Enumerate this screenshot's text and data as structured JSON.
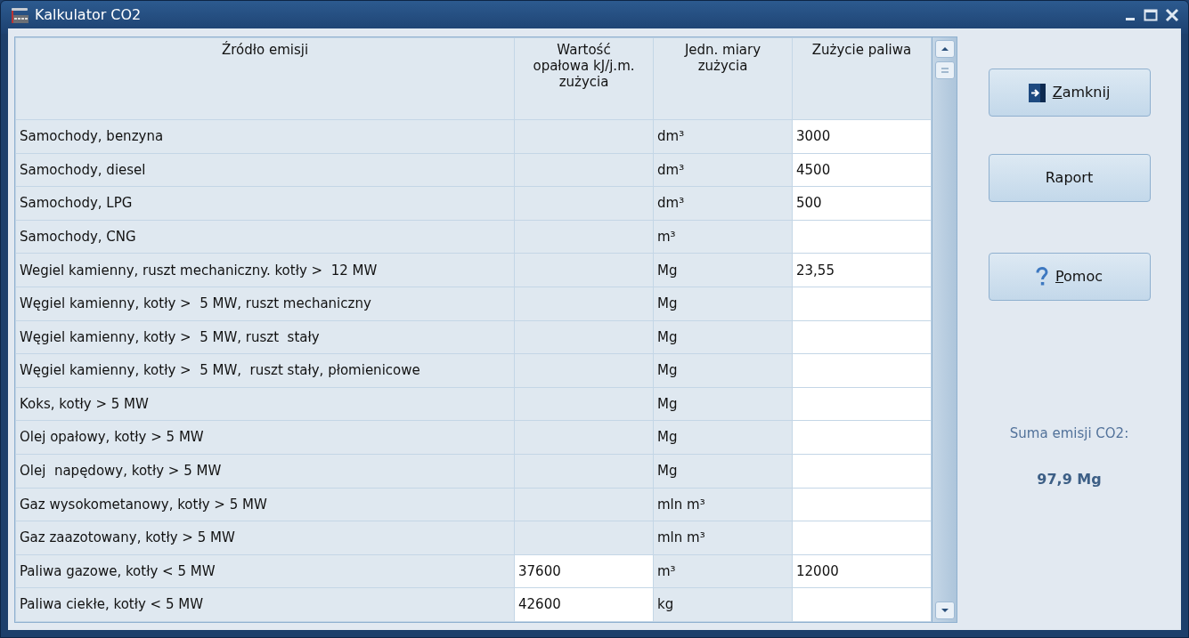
{
  "window": {
    "title": "Kalkulator CO2"
  },
  "table": {
    "columns": [
      "Źródło emisji",
      "Wartość opałowa kJ/j.m. zużycia",
      "Jedn. miary zużycia",
      "Zużycie paliwa"
    ],
    "rows": [
      {
        "source": "Samochody, benzyna",
        "value": "",
        "value_editable": false,
        "unit": "dm³",
        "usage": "3000"
      },
      {
        "source": "Samochody, diesel",
        "value": "",
        "value_editable": false,
        "unit": "dm³",
        "usage": "4500"
      },
      {
        "source": "Samochody, LPG",
        "value": "",
        "value_editable": false,
        "unit": "dm³",
        "usage": "500"
      },
      {
        "source": "Samochody, CNG",
        "value": "",
        "value_editable": false,
        "unit": "m³",
        "usage": ""
      },
      {
        "source": "Wegiel kamienny, ruszt mechaniczny. kotły >  12 MW",
        "value": "",
        "value_editable": false,
        "unit": "Mg",
        "usage": "23,55"
      },
      {
        "source": "Węgiel kamienny, kotły >  5 MW, ruszt mechaniczny",
        "value": "",
        "value_editable": false,
        "unit": "Mg",
        "usage": ""
      },
      {
        "source": "Węgiel kamienny, kotły >  5 MW, ruszt  stały",
        "value": "",
        "value_editable": false,
        "unit": "Mg",
        "usage": ""
      },
      {
        "source": "Węgiel kamienny, kotły >  5 MW,  ruszt stały, płomienicowe",
        "value": "",
        "value_editable": false,
        "unit": "Mg",
        "usage": ""
      },
      {
        "source": "Koks, kotły > 5 MW",
        "value": "",
        "value_editable": false,
        "unit": "Mg",
        "usage": ""
      },
      {
        "source": "Olej opałowy, kotły > 5 MW",
        "value": "",
        "value_editable": false,
        "unit": "Mg",
        "usage": ""
      },
      {
        "source": "Olej  napędowy, kotły > 5 MW",
        "value": "",
        "value_editable": false,
        "unit": "Mg",
        "usage": ""
      },
      {
        "source": "Gaz wysokometanowy, kotły > 5 MW",
        "value": "",
        "value_editable": false,
        "unit": "mln m³",
        "usage": ""
      },
      {
        "source": "Gaz zaazotowany, kotły > 5 MW",
        "value": "",
        "value_editable": false,
        "unit": "mln m³",
        "usage": ""
      },
      {
        "source": "Paliwa gazowe, kotły < 5 MW",
        "value": "37600",
        "value_editable": true,
        "unit": "m³",
        "usage": "12000"
      },
      {
        "source": "Paliwa ciekłe, kotły < 5 MW",
        "value": "42600",
        "value_editable": true,
        "unit": "kg",
        "usage": ""
      }
    ]
  },
  "buttons": [
    {
      "kind": "exit",
      "label": "Zamknij",
      "first_letter_underlined": true
    },
    {
      "kind": "plain",
      "label": "Raport",
      "first_letter_underlined": false
    },
    {
      "kind": "help",
      "label": "Pomoc",
      "first_letter_underlined": true
    }
  ],
  "summary": {
    "label": "Suma emisji CO2:",
    "value": "97,9 Mg"
  }
}
